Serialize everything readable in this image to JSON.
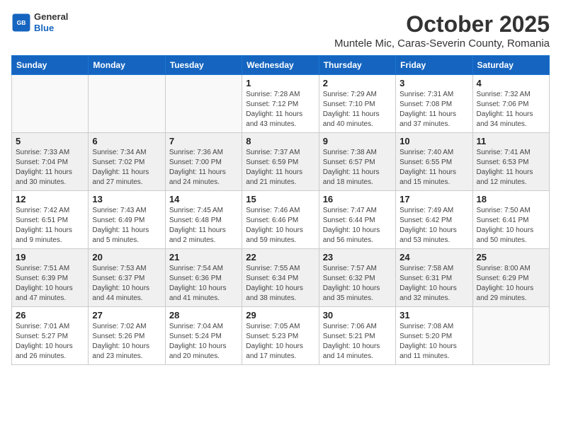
{
  "header": {
    "logo_general": "General",
    "logo_blue": "Blue",
    "month_title": "October 2025",
    "location": "Muntele Mic, Caras-Severin County, Romania"
  },
  "weekdays": [
    "Sunday",
    "Monday",
    "Tuesday",
    "Wednesday",
    "Thursday",
    "Friday",
    "Saturday"
  ],
  "weeks": [
    [
      {
        "day": "",
        "info": ""
      },
      {
        "day": "",
        "info": ""
      },
      {
        "day": "",
        "info": ""
      },
      {
        "day": "1",
        "info": "Sunrise: 7:28 AM\nSunset: 7:12 PM\nDaylight: 11 hours\nand 43 minutes."
      },
      {
        "day": "2",
        "info": "Sunrise: 7:29 AM\nSunset: 7:10 PM\nDaylight: 11 hours\nand 40 minutes."
      },
      {
        "day": "3",
        "info": "Sunrise: 7:31 AM\nSunset: 7:08 PM\nDaylight: 11 hours\nand 37 minutes."
      },
      {
        "day": "4",
        "info": "Sunrise: 7:32 AM\nSunset: 7:06 PM\nDaylight: 11 hours\nand 34 minutes."
      }
    ],
    [
      {
        "day": "5",
        "info": "Sunrise: 7:33 AM\nSunset: 7:04 PM\nDaylight: 11 hours\nand 30 minutes."
      },
      {
        "day": "6",
        "info": "Sunrise: 7:34 AM\nSunset: 7:02 PM\nDaylight: 11 hours\nand 27 minutes."
      },
      {
        "day": "7",
        "info": "Sunrise: 7:36 AM\nSunset: 7:00 PM\nDaylight: 11 hours\nand 24 minutes."
      },
      {
        "day": "8",
        "info": "Sunrise: 7:37 AM\nSunset: 6:59 PM\nDaylight: 11 hours\nand 21 minutes."
      },
      {
        "day": "9",
        "info": "Sunrise: 7:38 AM\nSunset: 6:57 PM\nDaylight: 11 hours\nand 18 minutes."
      },
      {
        "day": "10",
        "info": "Sunrise: 7:40 AM\nSunset: 6:55 PM\nDaylight: 11 hours\nand 15 minutes."
      },
      {
        "day": "11",
        "info": "Sunrise: 7:41 AM\nSunset: 6:53 PM\nDaylight: 11 hours\nand 12 minutes."
      }
    ],
    [
      {
        "day": "12",
        "info": "Sunrise: 7:42 AM\nSunset: 6:51 PM\nDaylight: 11 hours\nand 9 minutes."
      },
      {
        "day": "13",
        "info": "Sunrise: 7:43 AM\nSunset: 6:49 PM\nDaylight: 11 hours\nand 5 minutes."
      },
      {
        "day": "14",
        "info": "Sunrise: 7:45 AM\nSunset: 6:48 PM\nDaylight: 11 hours\nand 2 minutes."
      },
      {
        "day": "15",
        "info": "Sunrise: 7:46 AM\nSunset: 6:46 PM\nDaylight: 10 hours\nand 59 minutes."
      },
      {
        "day": "16",
        "info": "Sunrise: 7:47 AM\nSunset: 6:44 PM\nDaylight: 10 hours\nand 56 minutes."
      },
      {
        "day": "17",
        "info": "Sunrise: 7:49 AM\nSunset: 6:42 PM\nDaylight: 10 hours\nand 53 minutes."
      },
      {
        "day": "18",
        "info": "Sunrise: 7:50 AM\nSunset: 6:41 PM\nDaylight: 10 hours\nand 50 minutes."
      }
    ],
    [
      {
        "day": "19",
        "info": "Sunrise: 7:51 AM\nSunset: 6:39 PM\nDaylight: 10 hours\nand 47 minutes."
      },
      {
        "day": "20",
        "info": "Sunrise: 7:53 AM\nSunset: 6:37 PM\nDaylight: 10 hours\nand 44 minutes."
      },
      {
        "day": "21",
        "info": "Sunrise: 7:54 AM\nSunset: 6:36 PM\nDaylight: 10 hours\nand 41 minutes."
      },
      {
        "day": "22",
        "info": "Sunrise: 7:55 AM\nSunset: 6:34 PM\nDaylight: 10 hours\nand 38 minutes."
      },
      {
        "day": "23",
        "info": "Sunrise: 7:57 AM\nSunset: 6:32 PM\nDaylight: 10 hours\nand 35 minutes."
      },
      {
        "day": "24",
        "info": "Sunrise: 7:58 AM\nSunset: 6:31 PM\nDaylight: 10 hours\nand 32 minutes."
      },
      {
        "day": "25",
        "info": "Sunrise: 8:00 AM\nSunset: 6:29 PM\nDaylight: 10 hours\nand 29 minutes."
      }
    ],
    [
      {
        "day": "26",
        "info": "Sunrise: 7:01 AM\nSunset: 5:27 PM\nDaylight: 10 hours\nand 26 minutes."
      },
      {
        "day": "27",
        "info": "Sunrise: 7:02 AM\nSunset: 5:26 PM\nDaylight: 10 hours\nand 23 minutes."
      },
      {
        "day": "28",
        "info": "Sunrise: 7:04 AM\nSunset: 5:24 PM\nDaylight: 10 hours\nand 20 minutes."
      },
      {
        "day": "29",
        "info": "Sunrise: 7:05 AM\nSunset: 5:23 PM\nDaylight: 10 hours\nand 17 minutes."
      },
      {
        "day": "30",
        "info": "Sunrise: 7:06 AM\nSunset: 5:21 PM\nDaylight: 10 hours\nand 14 minutes."
      },
      {
        "day": "31",
        "info": "Sunrise: 7:08 AM\nSunset: 5:20 PM\nDaylight: 10 hours\nand 11 minutes."
      },
      {
        "day": "",
        "info": ""
      }
    ]
  ]
}
